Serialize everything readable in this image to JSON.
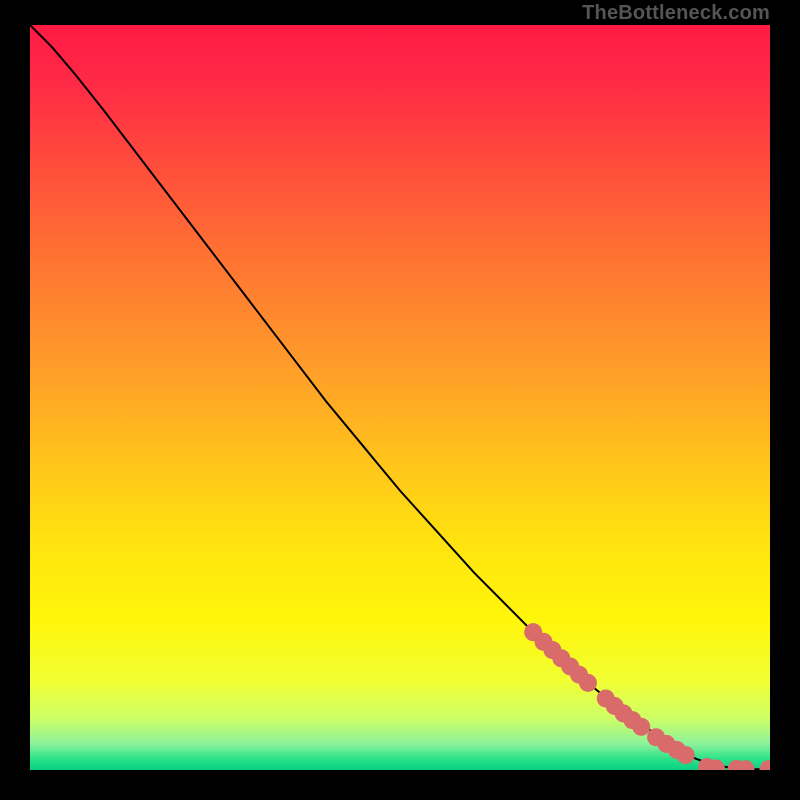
{
  "watermark": "TheBottleneck.com",
  "chart_data": {
    "type": "line",
    "title": "",
    "xlabel": "",
    "ylabel": "",
    "xlim": [
      0,
      100
    ],
    "ylim": [
      0,
      100
    ],
    "background_gradient_stops": [
      {
        "offset": 0.0,
        "color": "#ff1a44"
      },
      {
        "offset": 0.08,
        "color": "#ff2a46"
      },
      {
        "offset": 0.18,
        "color": "#ff4a3c"
      },
      {
        "offset": 0.3,
        "color": "#ff6f33"
      },
      {
        "offset": 0.45,
        "color": "#ff9a2a"
      },
      {
        "offset": 0.58,
        "color": "#ffc21c"
      },
      {
        "offset": 0.7,
        "color": "#ffe40f"
      },
      {
        "offset": 0.8,
        "color": "#fff60a"
      },
      {
        "offset": 0.88,
        "color": "#f1ff33"
      },
      {
        "offset": 0.93,
        "color": "#cfff66"
      },
      {
        "offset": 0.965,
        "color": "#8cf29a"
      },
      {
        "offset": 0.985,
        "color": "#2be28a"
      },
      {
        "offset": 1.0,
        "color": "#08d084"
      }
    ],
    "curve": {
      "x": [
        0,
        3,
        6,
        10,
        15,
        20,
        25,
        30,
        35,
        40,
        45,
        50,
        55,
        60,
        65,
        70,
        75,
        80,
        85,
        88,
        90,
        92,
        94,
        96,
        98,
        100
      ],
      "y": [
        100,
        97,
        93.5,
        88.5,
        82,
        75.5,
        69,
        62.5,
        56,
        49.5,
        43.5,
        37.5,
        32,
        26.5,
        21.5,
        16.5,
        12,
        8,
        4.5,
        2.5,
        1.5,
        0.8,
        0.4,
        0.2,
        0.1,
        0.1
      ]
    },
    "markers": {
      "color": "#d96b6b",
      "radius_px": 9,
      "points": [
        {
          "x": 68.0,
          "y": 18.5
        },
        {
          "x": 69.4,
          "y": 17.2
        },
        {
          "x": 70.6,
          "y": 16.1
        },
        {
          "x": 71.8,
          "y": 15.0
        },
        {
          "x": 73.0,
          "y": 13.9
        },
        {
          "x": 74.2,
          "y": 12.8
        },
        {
          "x": 75.4,
          "y": 11.7
        },
        {
          "x": 77.8,
          "y": 9.6
        },
        {
          "x": 79.0,
          "y": 8.6
        },
        {
          "x": 80.2,
          "y": 7.6
        },
        {
          "x": 81.4,
          "y": 6.7
        },
        {
          "x": 82.6,
          "y": 5.8
        },
        {
          "x": 84.6,
          "y": 4.4
        },
        {
          "x": 86.0,
          "y": 3.5
        },
        {
          "x": 87.4,
          "y": 2.7
        },
        {
          "x": 88.6,
          "y": 2.0
        },
        {
          "x": 91.5,
          "y": 0.4
        },
        {
          "x": 92.7,
          "y": 0.2
        },
        {
          "x": 95.5,
          "y": 0.15
        },
        {
          "x": 96.7,
          "y": 0.1
        },
        {
          "x": 99.8,
          "y": 0.1
        }
      ]
    }
  }
}
